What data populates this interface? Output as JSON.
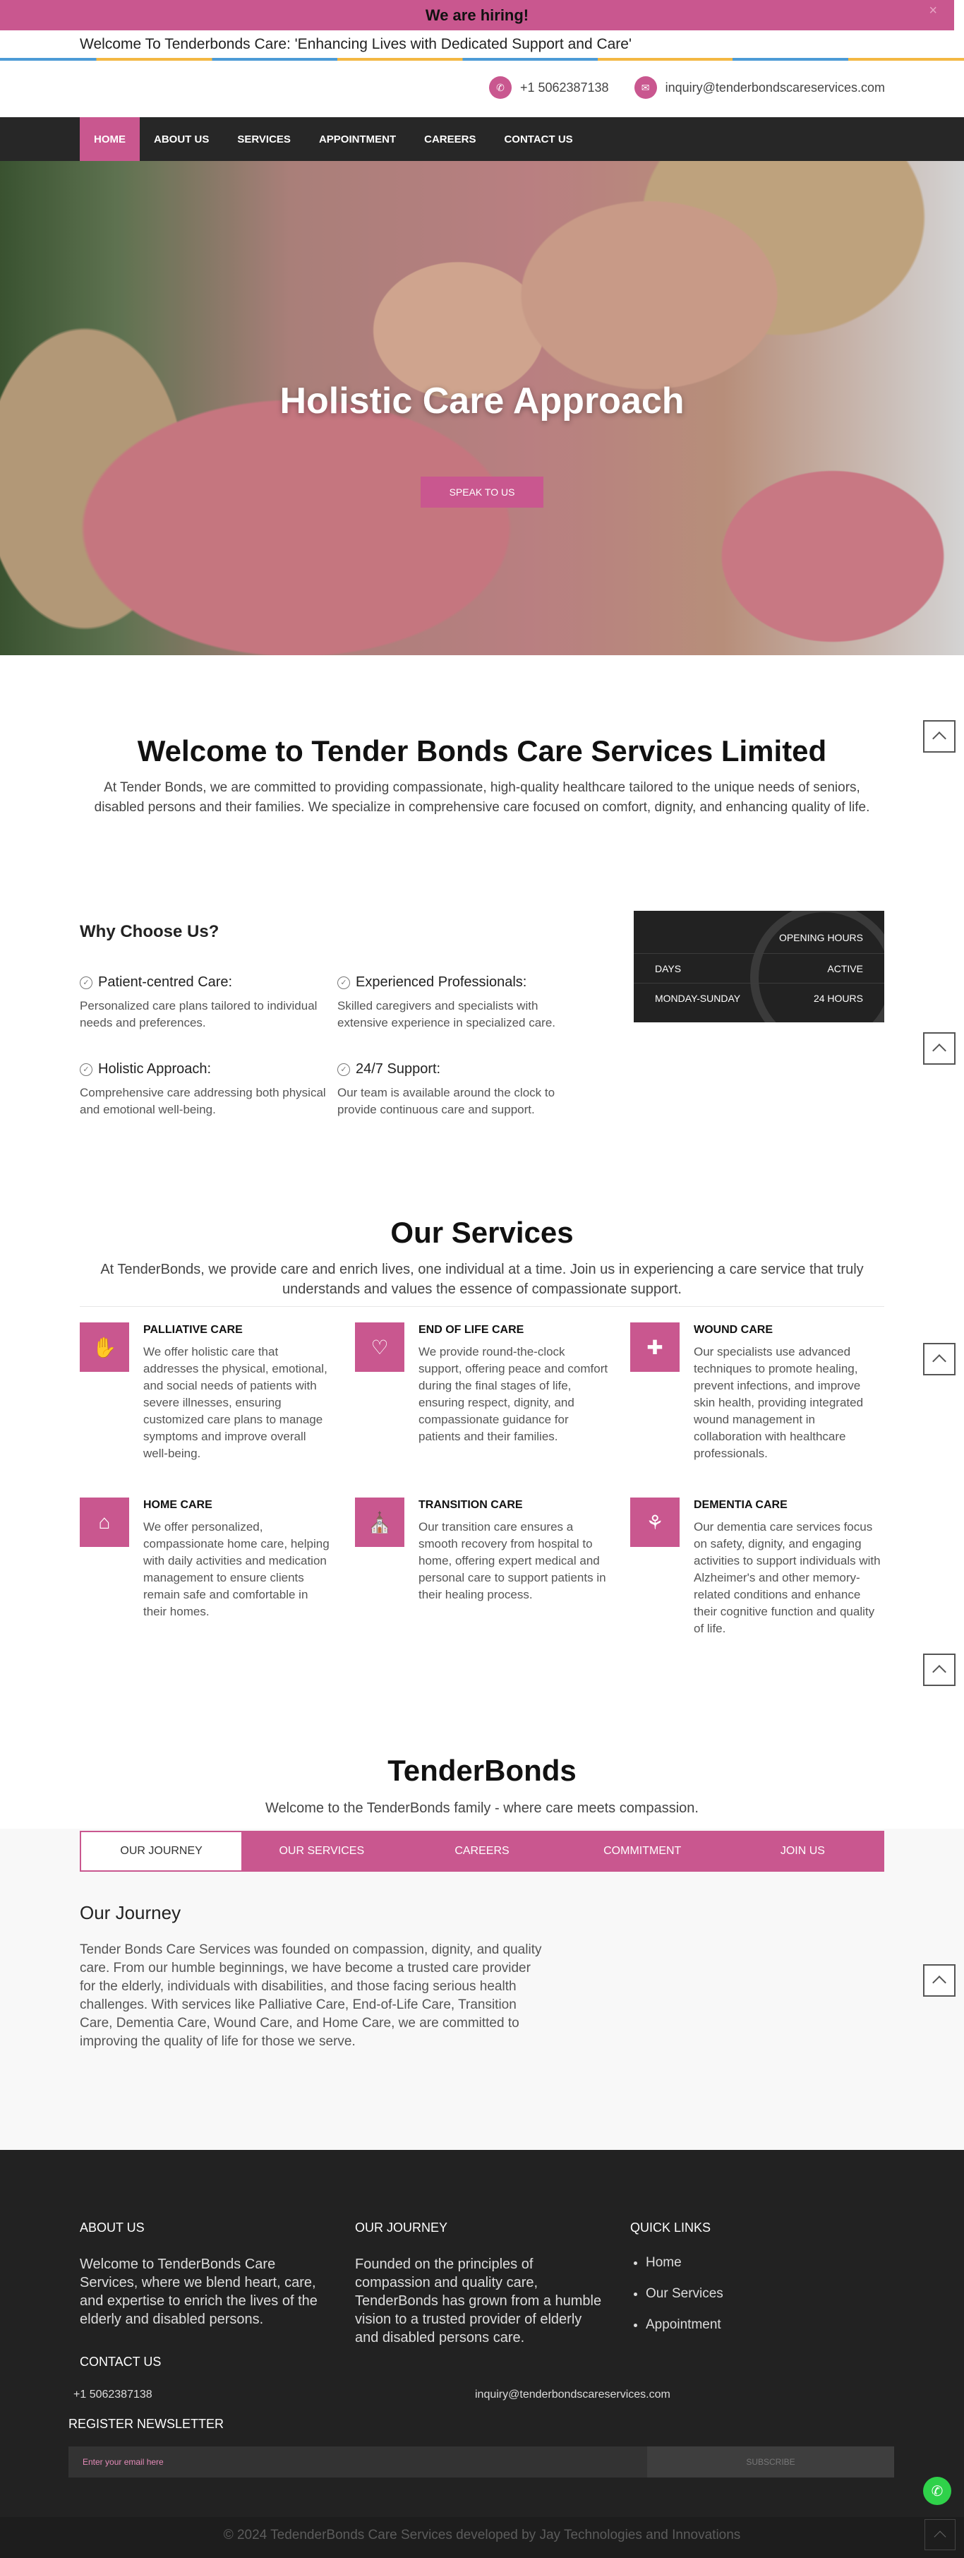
{
  "topbar": {
    "hiring_text": "We are hiring!",
    "close_glyph": "×",
    "welcome_text": "Welcome To Tenderbonds Care: 'Enhancing Lives with Dedicated Support and Care'",
    "phone": "+1 5062387138",
    "email": "inquiry@tenderbondscareservices.com",
    "phone_icon": "phone-icon",
    "email_icon": "mail-icon"
  },
  "nav": {
    "items": [
      "HOME",
      "ABOUT US",
      "SERVICES",
      "APPOINTMENT",
      "CAREERS",
      "CONTACT US"
    ],
    "active": "HOME"
  },
  "hero": {
    "title": "Holistic Care Approach",
    "button": "SPEAK TO US"
  },
  "welcome": {
    "title": "Welcome to Tender Bonds Care Services Limited",
    "text": "At Tender Bonds, we are committed to providing compassionate, high-quality healthcare tailored to the unique needs of seniors, disabled persons and their families. We specialize in comprehensive care focused on comfort, dignity, and enhancing quality of life."
  },
  "why": {
    "title": "Why Choose Us?",
    "items": [
      {
        "title": "Patient-centred Care:",
        "text": "Personalized care plans tailored to individual needs and preferences."
      },
      {
        "title": "Experienced Professionals:",
        "text": "Skilled caregivers and specialists with extensive experience in specialized care."
      },
      {
        "title": "Holistic Approach:",
        "text": "Comprehensive care addressing both physical and emotional well-being."
      },
      {
        "title": "24/7 Support:",
        "text": "Our team is available around the clock to provide continuous care and support."
      }
    ]
  },
  "hours": {
    "heading": "OPENING HOURS",
    "col1": "DAYS",
    "col2": "ACTIVE",
    "day": "MONDAY-SUNDAY",
    "time": "24 HOURS"
  },
  "services": {
    "title": "Our Services",
    "intro": "At TenderBonds, we provide care and enrich lives, one individual at a time. Join us in experiencing a care service that truly understands and values the essence of compassionate support.",
    "items": [
      {
        "title": "PALLIATIVE CARE",
        "text": "We offer holistic care that addresses the physical, emotional, and social needs of patients with severe illnesses, ensuring customized care plans to manage symptoms and improve overall well-being.",
        "icon": "hands-icon"
      },
      {
        "title": "END OF LIFE CARE",
        "text": "We provide round-the-clock support, offering peace and comfort during the final stages of life, ensuring respect, dignity, and compassionate guidance for patients and their families.",
        "icon": "heart-hands-icon"
      },
      {
        "title": "WOUND CARE",
        "text": "Our specialists use advanced techniques to promote healing, prevent infections, and improve skin health, providing integrated wound management in collaboration with healthcare professionals.",
        "icon": "bandage-icon"
      },
      {
        "title": "HOME CARE",
        "text": "We offer personalized, compassionate home care, helping with daily activities and medication management to ensure clients remain safe and comfortable in their homes.",
        "icon": "home-care-icon"
      },
      {
        "title": "TRANSITION CARE",
        "text": "Our transition care ensures a smooth recovery from hospital to home, offering expert medical and personal care to support patients in their healing process.",
        "icon": "hospital-icon"
      },
      {
        "title": "DEMENTIA CARE",
        "text": "Our dementia care services focus on safety, dignity, and engaging activities to support individuals with Alzheimer's and other memory-related conditions and enhance their cognitive function and quality of life.",
        "icon": "brain-icon"
      }
    ]
  },
  "tenderbonds": {
    "title": "TenderBonds",
    "subtitle": "Welcome to the TenderBonds family - where care meets compassion.",
    "tabs": [
      "OUR JOURNEY",
      "OUR SERVICES",
      "CAREERS",
      "COMMITMENT",
      "JOIN US"
    ],
    "active_tab": "OUR JOURNEY",
    "journey_title": "Our Journey",
    "journey_text": "Tender Bonds Care Services was founded on compassion, dignity, and quality care. From our humble beginnings, we have become a trusted care provider for the elderly, individuals with disabilities, and those facing serious health challenges. With services like Palliative Care, End-of-Life Care, Transition Care, Dementia Care, Wound Care, and Home Care, we are committed to improving the quality of life for those we serve."
  },
  "footer": {
    "about_title": "ABOUT US",
    "about_text": "Welcome to TenderBonds Care Services, where we blend heart, care, and expertise to enrich the lives of the elderly and disabled persons.",
    "journey_title": "OUR JOURNEY",
    "journey_text": "Founded on the principles of compassion and quality care, TenderBonds has grown from a humble vision to a trusted provider of elderly and disabled persons care.",
    "links_title": "QUICK LINKS",
    "links": [
      "Home",
      "Our Services",
      "Appointment"
    ],
    "contact_title": "CONTACT US",
    "phone": "+1 5062387138",
    "email": "inquiry@tenderbondscareservices.com",
    "newsletter_title": "REGISTER NEWSLETTER",
    "newsletter_placeholder": "Enter your email here",
    "subscribe": "SUBSCRIBE",
    "copyright": "© 2024 TedenderBonds Care Services developed by Jay Technologies and Innovations"
  },
  "colors": {
    "brand": "#c9578f",
    "dark": "#222222",
    "whatsapp": "#2fd14a"
  }
}
